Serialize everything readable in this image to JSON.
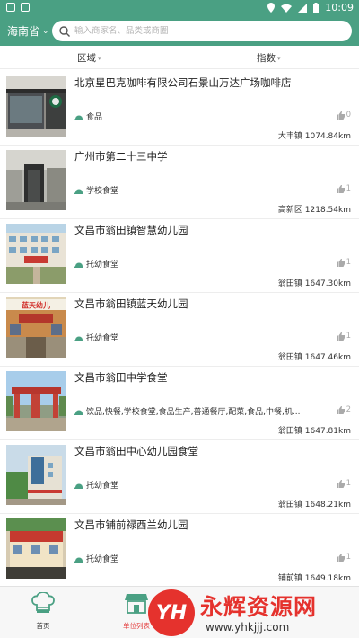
{
  "status_bar": {
    "time": "10:09"
  },
  "header": {
    "region": "海南省",
    "search_placeholder": "输入商家名、品类或商圈"
  },
  "filters": {
    "area": "区域",
    "index": "指数"
  },
  "items": [
    {
      "title": "北京星巴克咖啡有限公司石景山万达广场咖啡店",
      "category": "食品",
      "likes": "0",
      "district": "大丰镇",
      "distance": "1074.84km",
      "icon": "dome-icon",
      "photo": "cafe-storefront"
    },
    {
      "title": "广州市第二十三中学",
      "category": "学校食堂",
      "likes": "1",
      "district": "高新区",
      "distance": "1218.54km",
      "icon": "dome-icon",
      "photo": "school-corridor"
    },
    {
      "title": "文昌市翁田镇智慧幼儿园",
      "category": "托幼食堂",
      "likes": "1",
      "district": "翁田镇",
      "distance": "1647.30km",
      "icon": "dome-icon",
      "photo": "kindergarten-building"
    },
    {
      "title": "文昌市翁田镇蓝天幼儿园",
      "category": "托幼食堂",
      "likes": "1",
      "district": "翁田镇",
      "distance": "1647.46km",
      "icon": "dome-icon",
      "photo": "kindergarten-sign",
      "photo_text": "蓝天幼儿"
    },
    {
      "title": "文昌市翁田中学食堂",
      "category": "饮品,快餐,学校食堂,食品生产,普通餐厅,配菜,食品,中餐,机...",
      "likes": "2",
      "district": "翁田镇",
      "distance": "1647.81km",
      "icon": "dome-icon",
      "photo": "school-gate"
    },
    {
      "title": "文昌市翁田中心幼儿园食堂",
      "category": "托幼食堂",
      "likes": "1",
      "district": "翁田镇",
      "distance": "1648.21km",
      "icon": "dome-icon",
      "photo": "kindergarten-tower"
    },
    {
      "title": "文昌市铺前禄西兰幼儿园",
      "category": "托幼食堂",
      "likes": "1",
      "district": "铺前镇",
      "distance": "1649.18km",
      "icon": "dome-icon",
      "photo": "kindergarten-front"
    }
  ],
  "tabs": [
    {
      "label": "首页",
      "icon": "chef-hat-icon"
    },
    {
      "label": "单位列表",
      "icon": "store-icon"
    }
  ],
  "watermark": {
    "logo": "YH",
    "title": "永辉资源网",
    "url": "www.yhkjjj.com"
  },
  "colors": {
    "primary": "#4aa083",
    "accent": "#e33c3c",
    "watermark": "#e5322d"
  }
}
